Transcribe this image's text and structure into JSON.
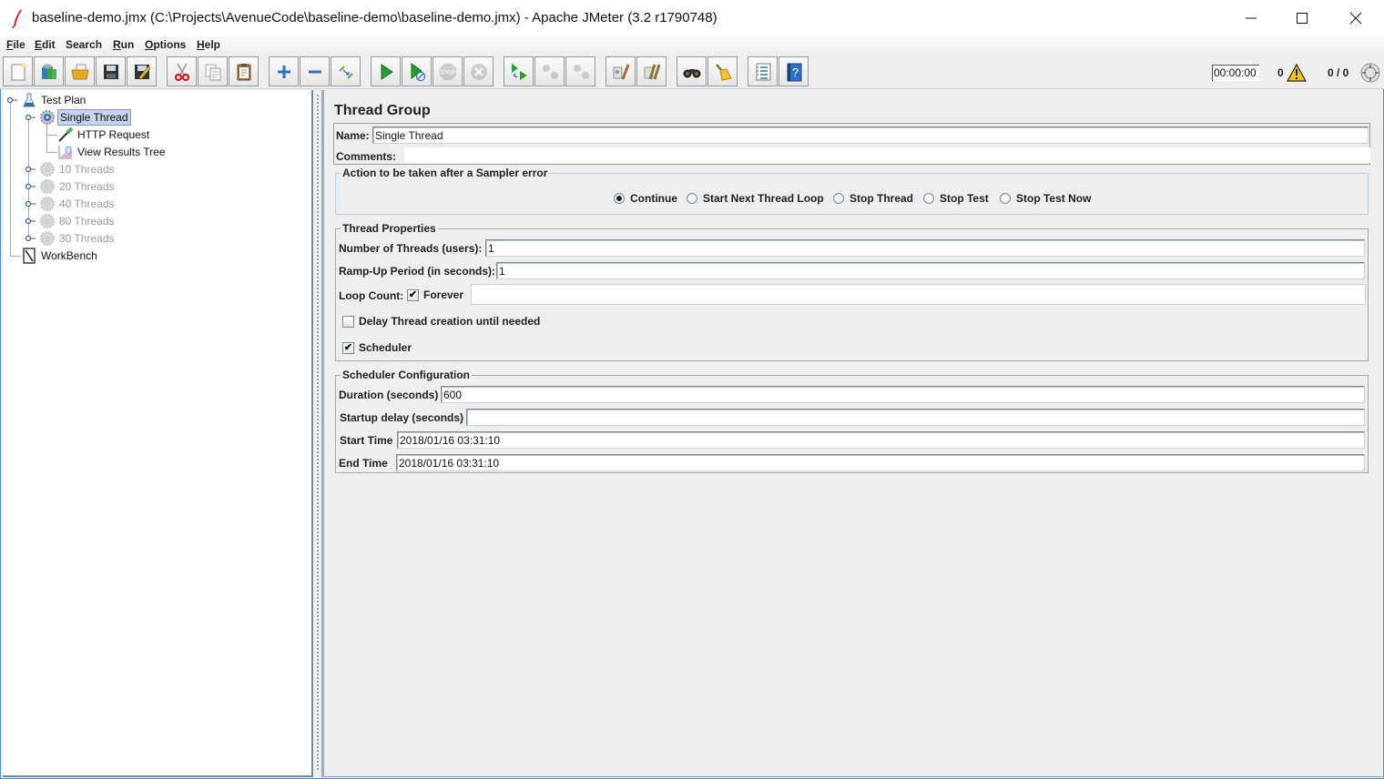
{
  "window": {
    "title": "baseline-demo.jmx (C:\\Projects\\AvenueCode\\baseline-demo\\baseline-demo.jmx) - Apache JMeter (3.2 r1790748)",
    "controls": [
      "minimize",
      "maximize",
      "close"
    ]
  },
  "menu": [
    {
      "label": "File",
      "mnemonic": "F"
    },
    {
      "label": "Edit",
      "mnemonic": "E"
    },
    {
      "label": "Search",
      "mnemonic": ""
    },
    {
      "label": "Run",
      "mnemonic": "R"
    },
    {
      "label": "Options",
      "mnemonic": "O"
    },
    {
      "label": "Help",
      "mnemonic": "H"
    }
  ],
  "toolbar": {
    "buttons": [
      {
        "icon": "new-icon",
        "enabled": true
      },
      {
        "icon": "templates-icon",
        "enabled": true
      },
      {
        "icon": "open-icon",
        "enabled": true
      },
      {
        "icon": "save-icon",
        "enabled": true
      },
      {
        "icon": "save-as-icon",
        "enabled": true
      },
      {
        "icon": "cut-icon",
        "enabled": true
      },
      {
        "icon": "copy-icon",
        "enabled": true
      },
      {
        "icon": "paste-icon",
        "enabled": true
      },
      {
        "icon": "expand-icon",
        "enabled": true
      },
      {
        "icon": "collapse-icon",
        "enabled": true
      },
      {
        "icon": "toggle-icon",
        "enabled": true
      },
      {
        "icon": "start-icon",
        "enabled": true
      },
      {
        "icon": "start-no-pauses-icon",
        "enabled": true
      },
      {
        "icon": "stop-icon",
        "enabled": false
      },
      {
        "icon": "shutdown-icon",
        "enabled": false
      },
      {
        "icon": "remote-start-icon",
        "enabled": true
      },
      {
        "icon": "remote-stop-icon",
        "enabled": false
      },
      {
        "icon": "remote-shutdown-icon",
        "enabled": false
      },
      {
        "icon": "clear-icon",
        "enabled": true
      },
      {
        "icon": "clear-all-icon",
        "enabled": true
      },
      {
        "icon": "search-icon",
        "enabled": true
      },
      {
        "icon": "reset-search-icon",
        "enabled": true
      },
      {
        "icon": "function-helper-icon",
        "enabled": true
      },
      {
        "icon": "help-icon",
        "enabled": true
      }
    ],
    "timer": "00:00:00",
    "error_count": "0",
    "active_threads": "0 / 0"
  },
  "tree": {
    "items": [
      {
        "label": "Test Plan",
        "icon": "test-plan-icon",
        "level": 0,
        "selected": false,
        "disabled": false
      },
      {
        "label": "Single Thread",
        "icon": "thread-group-icon",
        "level": 1,
        "selected": true,
        "disabled": false
      },
      {
        "label": "HTTP Request",
        "icon": "http-sampler-icon",
        "level": 2,
        "selected": false,
        "disabled": false
      },
      {
        "label": "View Results Tree",
        "icon": "listener-icon",
        "level": 2,
        "selected": false,
        "disabled": false
      },
      {
        "label": "10 Threads",
        "icon": "thread-group-icon",
        "level": 1,
        "selected": false,
        "disabled": true
      },
      {
        "label": "20 Threads",
        "icon": "thread-group-icon",
        "level": 1,
        "selected": false,
        "disabled": true
      },
      {
        "label": "40 Threads",
        "icon": "thread-group-icon",
        "level": 1,
        "selected": false,
        "disabled": true
      },
      {
        "label": "80 Threads",
        "icon": "thread-group-icon",
        "level": 1,
        "selected": false,
        "disabled": true
      },
      {
        "label": "30 Threads",
        "icon": "thread-group-icon",
        "level": 1,
        "selected": false,
        "disabled": true
      },
      {
        "label": "WorkBench",
        "icon": "workbench-icon",
        "level": 0,
        "selected": false,
        "disabled": false
      }
    ]
  },
  "panel": {
    "title": "Thread Group",
    "name_label": "Name:",
    "name_value": "Single Thread",
    "comments_label": "Comments:",
    "comments_value": "",
    "sampler_error": {
      "legend": "Action to be taken after a Sampler error",
      "options": [
        "Continue",
        "Start Next Thread Loop",
        "Stop Thread",
        "Stop Test",
        "Stop Test Now"
      ],
      "selected": "Continue"
    },
    "thread_properties": {
      "legend": "Thread Properties",
      "num_threads_label": "Number of Threads (users):",
      "num_threads_value": "1",
      "ramp_up_label": "Ramp-Up Period (in seconds):",
      "ramp_up_value": "1",
      "loop_count_label": "Loop Count:",
      "forever_label": "Forever",
      "forever_checked": true,
      "loop_count_value": "",
      "delay_label": "Delay Thread creation until needed",
      "delay_checked": false,
      "scheduler_label": "Scheduler",
      "scheduler_checked": true
    },
    "scheduler_config": {
      "legend": "Scheduler Configuration",
      "duration_label": "Duration (seconds)",
      "duration_value": "600",
      "startup_delay_label": "Startup delay (seconds)",
      "startup_delay_value": "",
      "start_time_label": "Start Time",
      "start_time_value": "2018/01/16 03:31:10",
      "end_time_label": "End Time",
      "end_time_value": "2018/01/16 03:31:10"
    }
  }
}
